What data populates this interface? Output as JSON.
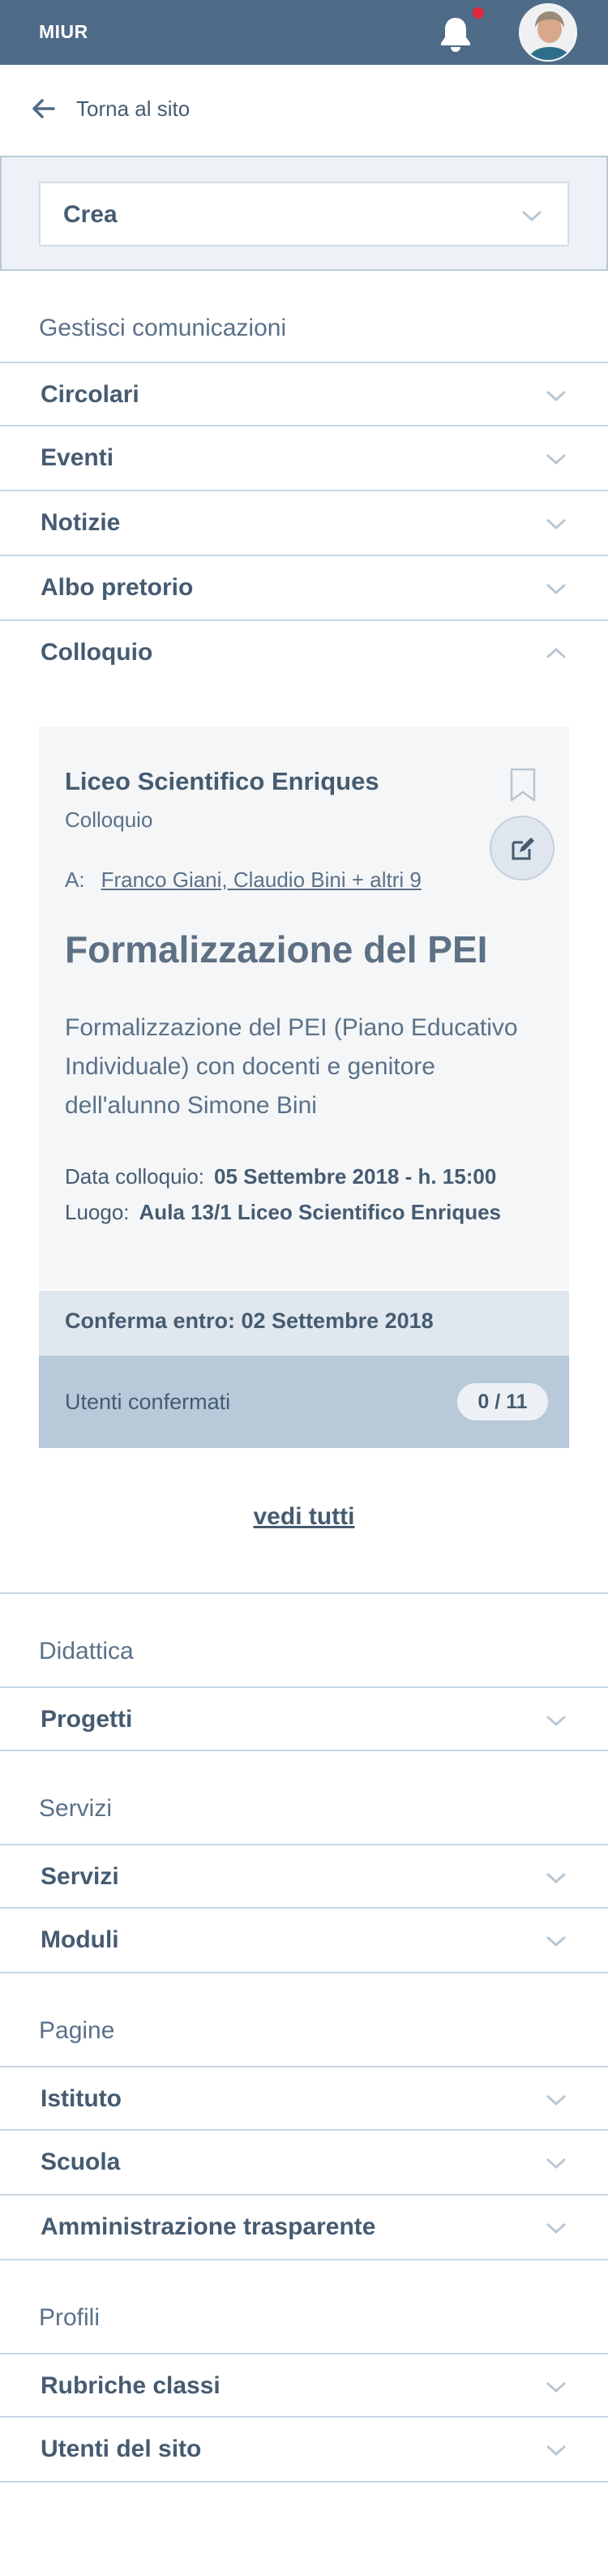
{
  "topbar": {
    "brand": "MIUR",
    "notification_badge": true,
    "colors": {
      "bar": "#4e6b87",
      "badge": "#e3263a"
    }
  },
  "back_link": {
    "label": "Torna al sito",
    "icon": "arrow-left-icon"
  },
  "create_select": {
    "value": "Crea",
    "icon": "chevron-down-icon"
  },
  "sections": {
    "comunicazioni": {
      "title": "Gestisci comunicazioni",
      "items": [
        "Circolari",
        "Eventi",
        "Notizie",
        "Albo pretorio",
        "Colloquio"
      ]
    },
    "didattica": {
      "title": "Didattica",
      "items": [
        "Progetti"
      ]
    },
    "servizi": {
      "title": "Servizi",
      "items": [
        "Servizi",
        "Moduli"
      ]
    },
    "pagine": {
      "title": "Pagine",
      "items": [
        "Istituto",
        "Scuola",
        "Amministrazione trasparente"
      ]
    },
    "profili": {
      "title": "Profili",
      "items": [
        "Rubriche classi",
        "Utenti del sito"
      ]
    }
  },
  "card": {
    "school": "Liceo Scientifico Enriques",
    "type": "Colloquio",
    "to_label": "A:",
    "to_value": "Franco Giani, Claudio Bini + altri 9",
    "heading": "Formalizzazione del PEI",
    "description": "Formalizzazione del PEI (Piano Educativo Individuale) con docenti e genitore dell'alunno Simone Bini",
    "date_label": "Data colloquio:",
    "date_value": "05 Settembre 2018 - h. 15:00",
    "place_label": "Luogo:",
    "place_value": "Aula 13/1 Liceo Scientifico Enriques",
    "confirm_by": "Conferma entro: 02 Settembre 2018",
    "users_label": "Utenti confermati",
    "users_count": "0 / 11"
  },
  "see_all": "vedi tutti"
}
